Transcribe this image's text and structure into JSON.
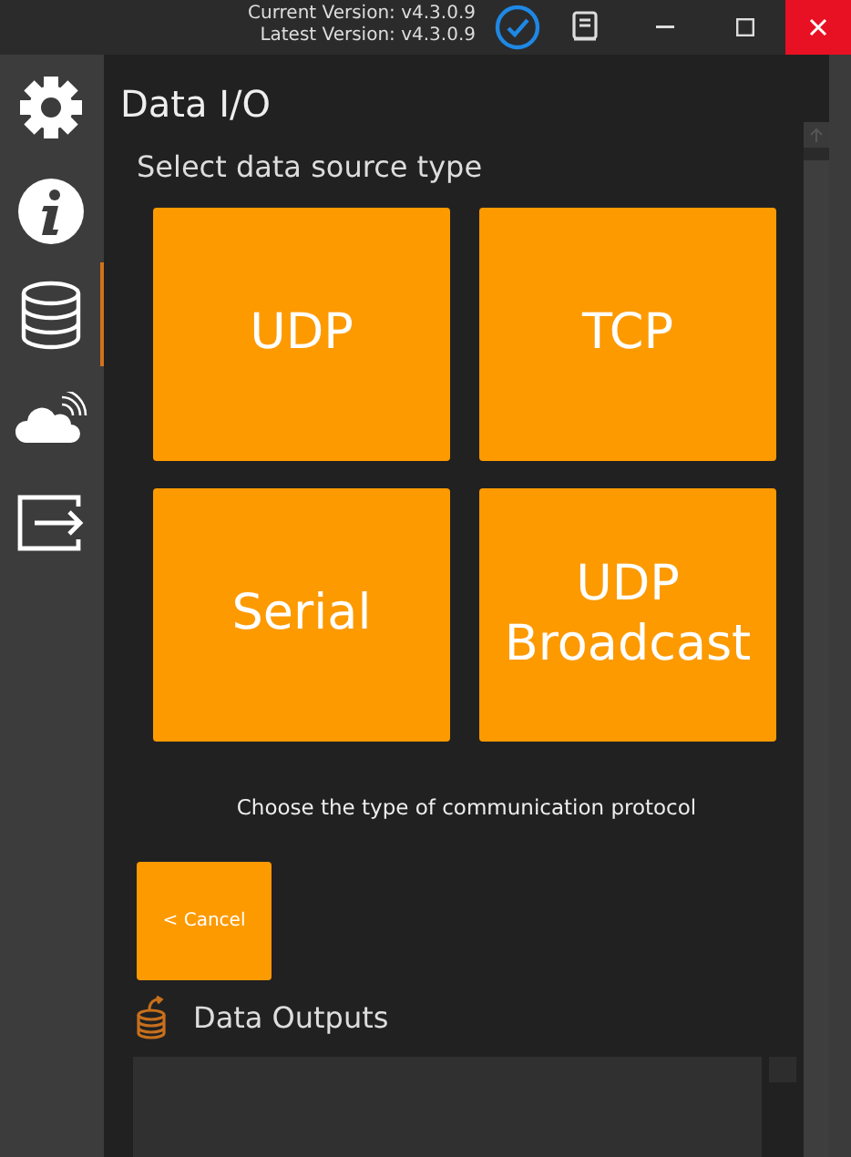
{
  "title_bar": {
    "current_version": "Current Version: v4.3.0.9",
    "latest_version": "Latest Version: v4.3.0.9"
  },
  "sidebar": {
    "items": [
      {
        "selected": false
      },
      {
        "selected": false
      },
      {
        "selected": true
      },
      {
        "selected": false
      },
      {
        "selected": false
      }
    ]
  },
  "page": {
    "title": "Data I/O",
    "subtitle": "Select data source type",
    "source_types": [
      {
        "label": "UDP"
      },
      {
        "label": "TCP"
      },
      {
        "label": "Serial"
      },
      {
        "label": "UDP Broadcast"
      }
    ],
    "hint": "Choose the type of communication protocol",
    "cancel_button": "< Cancel",
    "outputs_heading": "Data Outputs"
  }
}
